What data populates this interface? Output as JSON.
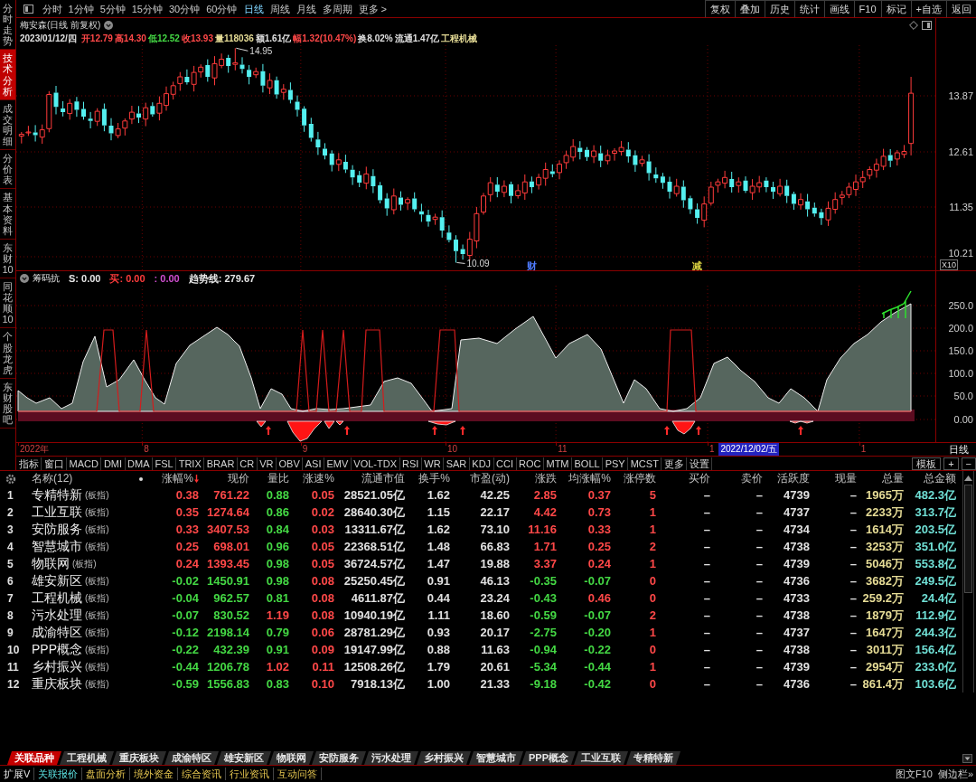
{
  "sidebar": {
    "tabs": [
      {
        "label": "分时走势",
        "selected": false
      },
      {
        "label": "技术分析",
        "selected": true
      },
      {
        "label": "成交明细",
        "selected": false
      },
      {
        "label": "分价表",
        "selected": false
      },
      {
        "label": "基本资料",
        "selected": false
      },
      {
        "label": "东财10",
        "selected": false
      },
      {
        "label": "同花顺10",
        "selected": false
      },
      {
        "label": "个股龙虎",
        "selected": false
      },
      {
        "label": "东财股吧",
        "selected": false
      }
    ]
  },
  "toolbar": {
    "periods": [
      {
        "label": "分时",
        "selected": false
      },
      {
        "label": "1分钟",
        "selected": false
      },
      {
        "label": "5分钟",
        "selected": false
      },
      {
        "label": "15分钟",
        "selected": false
      },
      {
        "label": "30分钟",
        "selected": false
      },
      {
        "label": "60分钟",
        "selected": false
      },
      {
        "label": "日线",
        "selected": true
      },
      {
        "label": "周线",
        "selected": false
      },
      {
        "label": "月线",
        "selected": false
      },
      {
        "label": "多周期",
        "selected": false
      },
      {
        "label": "更多 >",
        "selected": false
      }
    ],
    "actions": [
      "复权",
      "叠加",
      "历史",
      "统计",
      "画线",
      "F10",
      "标记",
      "+自选",
      "返回"
    ]
  },
  "price_chart": {
    "title": "梅安森(日线 前复权)",
    "quote": [
      {
        "text": "2023/01/12/四",
        "color": "#e0e0e0"
      },
      {
        "text": "开12.79",
        "color": "#ff4848"
      },
      {
        "text": "高14.30",
        "color": "#ff4848"
      },
      {
        "text": "低12.52",
        "color": "#44d844"
      },
      {
        "text": "收13.93",
        "color": "#ff4848"
      },
      {
        "text": "量118036",
        "color": "#e6dc96"
      },
      {
        "text": "额1.61亿",
        "color": "#e0e0e0"
      },
      {
        "text": "幅1.32(10.47%)",
        "color": "#ff4848"
      },
      {
        "text": "换8.02%",
        "color": "#e0e0e0"
      },
      {
        "text": "流通1.47亿",
        "color": "#e0e0e0"
      },
      {
        "text": "工程机械",
        "color": "#e6dc96"
      }
    ],
    "high_label": "14.95",
    "low_label": "10.09",
    "events": [
      {
        "text": "财",
        "color": "#4f7cff"
      },
      {
        "text": "减",
        "color": "#d8d040"
      }
    ],
    "y_ticks": [
      "13.87",
      "12.61",
      "11.35",
      "10.21"
    ],
    "scale_label": "X10"
  },
  "indicator": {
    "name": "筹码抗",
    "legend": [
      {
        "text": "S: 0.00",
        "color": "#e6e6e6"
      },
      {
        "text": "买: 0.00",
        "color": "#ff3c3c"
      },
      {
        "text": ": 0.00",
        "color": "#d24fd2"
      },
      {
        "text": "趋势线: 279.67",
        "color": "#e6e6e6"
      }
    ],
    "y_ticks": [
      "250.0",
      "200.0",
      "150.0",
      "100.0",
      "50.0",
      "0.00"
    ]
  },
  "time_axis": {
    "labels": [
      "2022年",
      "8",
      "9",
      "10",
      "11",
      "1",
      "1"
    ],
    "cursor_date": "2022/12/02/五",
    "period": "日线"
  },
  "indicator_tabs": {
    "items": [
      "指标",
      "窗口",
      "MACD",
      "DMI",
      "DMA",
      "FSL",
      "TRIX",
      "BRAR",
      "CR",
      "VR",
      "OBV",
      "ASI",
      "EMV",
      "VOL-TDX",
      "RSI",
      "WR",
      "SAR",
      "KDJ",
      "CCI",
      "ROC",
      "MTM",
      "BOLL",
      "PSY",
      "MCST",
      "更多",
      "设置"
    ],
    "controls": [
      "模板",
      "+",
      "−"
    ]
  },
  "table": {
    "title": "名称(12)",
    "columns": [
      {
        "label": "涨幅%",
        "sorted": true
      },
      {
        "label": "现价",
        "sorted": false
      },
      {
        "label": "量比",
        "sorted": false
      },
      {
        "label": "涨速%",
        "sorted": false
      },
      {
        "label": "流通市值",
        "sorted": false
      },
      {
        "label": "换手%",
        "sorted": false
      },
      {
        "label": "市盈(动)",
        "sorted": false
      },
      {
        "label": "涨跌",
        "sorted": false
      },
      {
        "label": "均涨幅%",
        "sorted": false
      },
      {
        "label": "涨停数",
        "sorted": false
      },
      {
        "label": "买价",
        "sorted": false
      },
      {
        "label": "卖价",
        "sorted": false
      },
      {
        "label": "活跃度",
        "sorted": false
      },
      {
        "label": "现量",
        "sorted": false
      },
      {
        "label": "总量",
        "sorted": false
      },
      {
        "label": "总金额",
        "sorted": false
      }
    ],
    "rows": [
      {
        "no": "1",
        "name": "专精特新",
        "tag": "(板指)",
        "rising": true,
        "volume_ratio_rising": false,
        "avg_change_rising": true,
        "values": [
          "0.38",
          "761.22",
          "0.88",
          "0.05",
          "28521.05亿",
          "1.62",
          "42.25",
          "2.85",
          "0.37",
          "5",
          "–",
          "–",
          "4739",
          "–",
          "1965万",
          "482.3亿"
        ]
      },
      {
        "no": "2",
        "name": "工业互联",
        "tag": "(板指)",
        "rising": true,
        "volume_ratio_rising": false,
        "avg_change_rising": true,
        "values": [
          "0.35",
          "1274.64",
          "0.86",
          "0.02",
          "28640.30亿",
          "1.15",
          "22.17",
          "4.42",
          "0.73",
          "1",
          "–",
          "–",
          "4737",
          "–",
          "2233万",
          "313.7亿"
        ]
      },
      {
        "no": "3",
        "name": "安防服务",
        "tag": "(板指)",
        "rising": true,
        "volume_ratio_rising": false,
        "avg_change_rising": true,
        "values": [
          "0.33",
          "3407.53",
          "0.84",
          "0.03",
          "13311.67亿",
          "1.62",
          "73.10",
          "11.16",
          "0.33",
          "1",
          "–",
          "–",
          "4734",
          "–",
          "1614万",
          "203.5亿"
        ]
      },
      {
        "no": "4",
        "name": "智慧城市",
        "tag": "(板指)",
        "rising": true,
        "volume_ratio_rising": false,
        "avg_change_rising": true,
        "values": [
          "0.25",
          "698.01",
          "0.96",
          "0.05",
          "22368.51亿",
          "1.48",
          "66.83",
          "1.71",
          "0.25",
          "2",
          "–",
          "–",
          "4738",
          "–",
          "3253万",
          "351.0亿"
        ]
      },
      {
        "no": "5",
        "name": "物联网",
        "tag": "(板指)",
        "rising": true,
        "volume_ratio_rising": false,
        "avg_change_rising": true,
        "values": [
          "0.24",
          "1393.45",
          "0.98",
          "0.05",
          "36724.57亿",
          "1.47",
          "19.88",
          "3.37",
          "0.24",
          "1",
          "–",
          "–",
          "4739",
          "–",
          "5046万",
          "553.8亿"
        ]
      },
      {
        "no": "6",
        "name": "雄安新区",
        "tag": "(板指)",
        "rising": false,
        "volume_ratio_rising": false,
        "avg_change_rising": false,
        "values": [
          "-0.02",
          "1450.91",
          "0.98",
          "0.08",
          "25250.45亿",
          "0.91",
          "46.13",
          "-0.35",
          "-0.07",
          "0",
          "–",
          "–",
          "4736",
          "–",
          "3682万",
          "249.5亿"
        ]
      },
      {
        "no": "7",
        "name": "工程机械",
        "tag": "(板指)",
        "rising": false,
        "volume_ratio_rising": false,
        "avg_change_rising": true,
        "values": [
          "-0.04",
          "962.57",
          "0.81",
          "0.08",
          "4611.87亿",
          "0.44",
          "23.24",
          "-0.43",
          "0.46",
          "0",
          "–",
          "–",
          "4733",
          "–",
          "259.2万",
          "24.4亿"
        ]
      },
      {
        "no": "8",
        "name": "污水处理",
        "tag": "(板指)",
        "rising": false,
        "volume_ratio_rising": true,
        "avg_change_rising": false,
        "values": [
          "-0.07",
          "830.52",
          "1.19",
          "0.08",
          "10940.19亿",
          "1.11",
          "18.60",
          "-0.59",
          "-0.07",
          "2",
          "–",
          "–",
          "4738",
          "–",
          "1879万",
          "112.9亿"
        ]
      },
      {
        "no": "9",
        "name": "成渝特区",
        "tag": "(板指)",
        "rising": false,
        "volume_ratio_rising": false,
        "avg_change_rising": false,
        "values": [
          "-0.12",
          "2198.14",
          "0.79",
          "0.06",
          "28781.29亿",
          "0.93",
          "20.17",
          "-2.75",
          "-0.20",
          "1",
          "–",
          "–",
          "4737",
          "–",
          "1647万",
          "244.3亿"
        ]
      },
      {
        "no": "10",
        "name": "PPP概念",
        "tag": "(板指)",
        "rising": false,
        "volume_ratio_rising": false,
        "avg_change_rising": false,
        "values": [
          "-0.22",
          "432.39",
          "0.91",
          "0.09",
          "19147.99亿",
          "0.88",
          "11.63",
          "-0.94",
          "-0.22",
          "0",
          "–",
          "–",
          "4738",
          "–",
          "3011万",
          "156.4亿"
        ]
      },
      {
        "no": "11",
        "name": "乡村振兴",
        "tag": "(板指)",
        "rising": false,
        "volume_ratio_rising": true,
        "avg_change_rising": false,
        "values": [
          "-0.44",
          "1206.78",
          "1.02",
          "0.11",
          "12508.26亿",
          "1.79",
          "20.61",
          "-5.34",
          "-0.44",
          "1",
          "–",
          "–",
          "4739",
          "–",
          "2954万",
          "233.0亿"
        ]
      },
      {
        "no": "12",
        "name": "重庆板块",
        "tag": "(板指)",
        "rising": false,
        "volume_ratio_rising": false,
        "avg_change_rising": false,
        "values": [
          "-0.59",
          "1556.83",
          "0.83",
          "0.10",
          "7918.13亿",
          "1.00",
          "21.33",
          "-9.18",
          "-0.42",
          "0",
          "–",
          "–",
          "4736",
          "–",
          "861.4万",
          "103.6亿"
        ]
      }
    ]
  },
  "sector_tabs": [
    {
      "label": "关联品种",
      "selected": true
    },
    {
      "label": "工程机械",
      "selected": false
    },
    {
      "label": "重庆板块",
      "selected": false
    },
    {
      "label": "成渝特区",
      "selected": false
    },
    {
      "label": "雄安新区",
      "selected": false
    },
    {
      "label": "物联网",
      "selected": false
    },
    {
      "label": "安防服务",
      "selected": false
    },
    {
      "label": "污水处理",
      "selected": false
    },
    {
      "label": "乡村振兴",
      "selected": false
    },
    {
      "label": "智慧城市",
      "selected": false
    },
    {
      "label": "PPP概念",
      "selected": false
    },
    {
      "label": "工业互联",
      "selected": false
    },
    {
      "label": "专精特新",
      "selected": false
    }
  ],
  "status_bar": {
    "menu": "扩展V",
    "tabs": [
      {
        "label": "关联报价",
        "selected": true
      },
      {
        "label": "盘面分析",
        "selected": false
      },
      {
        "label": "境外资金",
        "selected": false
      },
      {
        "label": "综合资讯",
        "selected": false
      },
      {
        "label": "行业资讯",
        "selected": false
      },
      {
        "label": "互动问答",
        "selected": false
      }
    ],
    "links": [
      "图文F10",
      "侧边栏»"
    ]
  }
}
